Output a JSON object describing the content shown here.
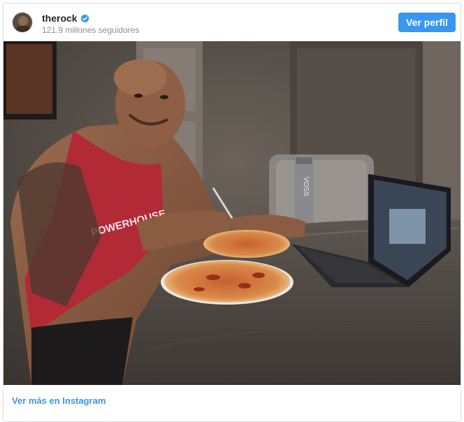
{
  "profile": {
    "username": "therock",
    "followers": "121.9 millones seguidores",
    "view_profile_label": "Ver perfil",
    "verified_icon": "verified-badge-icon"
  },
  "post": {
    "photo_description": "man eating pizza at table with laptop",
    "bottle_text": "VOSS",
    "shirt_text": "POWERHOUSE"
  },
  "footer": {
    "link_label": "Ver más en Instagram"
  },
  "colors": {
    "accent": "#3897f0",
    "username": "#262626",
    "secondary_text": "#8e8e8e",
    "border": "#dbdbdb"
  }
}
